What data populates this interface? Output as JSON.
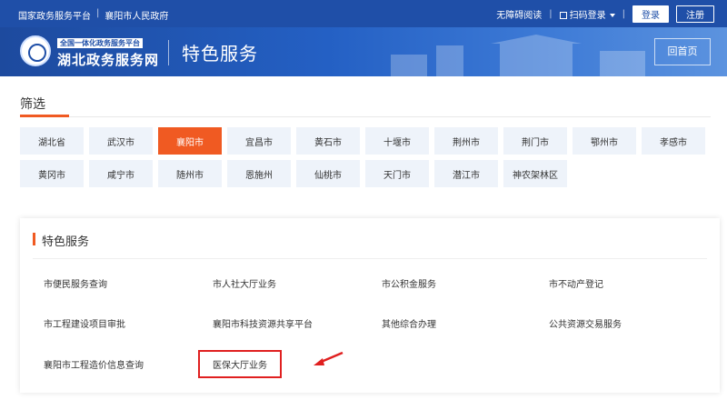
{
  "topbar": {
    "platform": "国家政务服务平台",
    "sep": "|",
    "gov": "襄阳市人民政府",
    "accessibility": "无障碍阅读",
    "scan_login": "扫码登录",
    "login": "登录",
    "register": "注册"
  },
  "header": {
    "logo_small": "全国一体化政务服务平台",
    "logo_main": "湖北政务服务网",
    "title": "特色服务",
    "home": "回首页"
  },
  "filter": {
    "title": "筛选",
    "cities": [
      "湖北省",
      "武汉市",
      "襄阳市",
      "宜昌市",
      "黄石市",
      "十堰市",
      "荆州市",
      "荆门市",
      "鄂州市",
      "孝感市",
      "黄冈市",
      "咸宁市",
      "随州市",
      "恩施州",
      "仙桃市",
      "天门市",
      "潜江市",
      "神农架林区"
    ],
    "active_index": 2,
    "active_color": "#f05a22"
  },
  "services": {
    "title": "特色服务",
    "items": [
      "市便民服务查询",
      "市人社大厅业务",
      "市公积金服务",
      "市不动产登记",
      "市工程建设项目审批",
      "襄阳市科技资源共享平台",
      "其他综合办理",
      "公共资源交易服务",
      "襄阳市工程造价信息查询",
      "医保大厅业务"
    ],
    "highlighted_index": 9,
    "highlight_color": "#e02020"
  }
}
